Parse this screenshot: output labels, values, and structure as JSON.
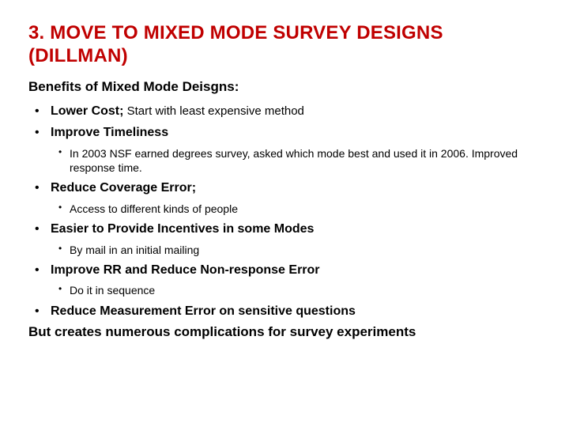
{
  "title": "3. MOVE TO MIXED MODE SURVEY DESIGNS (DILLMAN)",
  "subtitle": "Benefits of Mixed Mode Deisgns:",
  "items": [
    {
      "bold": "Lower Cost;",
      "detail": " Start with least expensive method",
      "sub": []
    },
    {
      "bold": "Improve Timeliness",
      "detail": "",
      "sub": [
        "In 2003 NSF earned degrees survey, asked which mode best and used it in 2006. Improved response time."
      ]
    },
    {
      "bold": "Reduce Coverage Error;",
      "detail": "",
      "sub": [
        "Access to different kinds of people"
      ]
    },
    {
      "bold": "Easier to Provide Incentives in some Modes",
      "detail": "",
      "sub": [
        "By mail in an initial mailing"
      ]
    },
    {
      "bold": "Improve RR and Reduce Non-response Error",
      "detail": "",
      "sub": [
        "Do it in sequence"
      ]
    },
    {
      "bold": "Reduce Measurement Error on sensitive questions",
      "detail": "",
      "sub": []
    }
  ],
  "closing": "But creates numerous complications for survey experiments"
}
